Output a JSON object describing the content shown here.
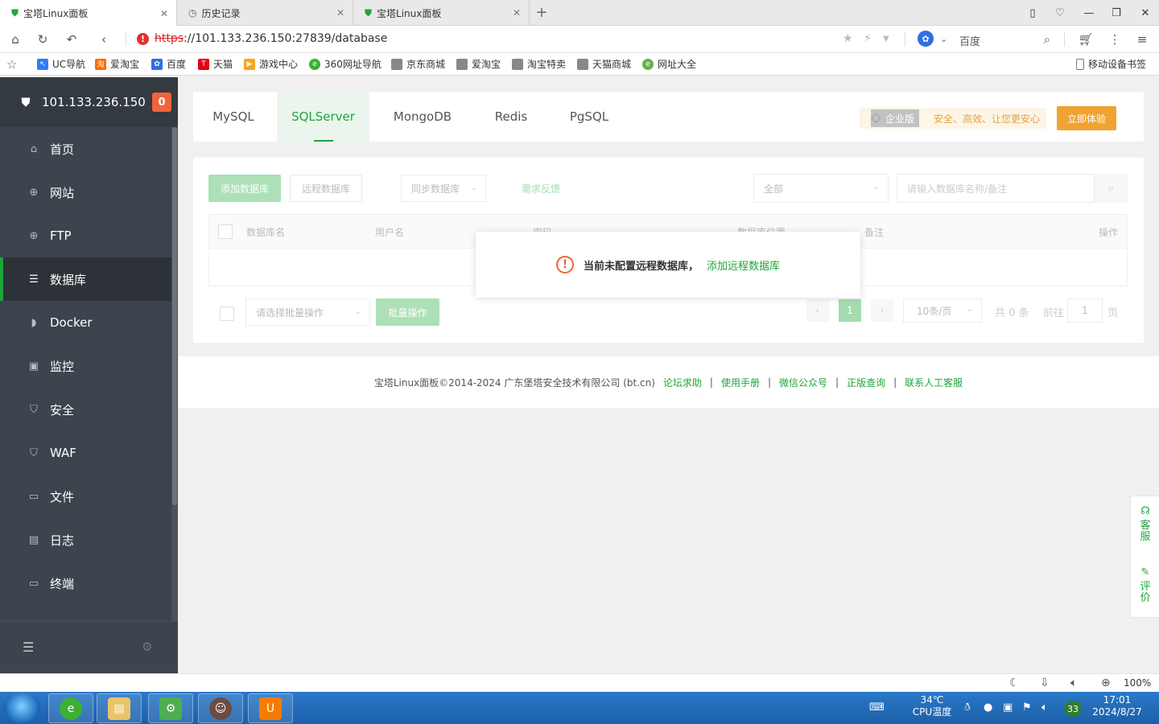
{
  "browser": {
    "tabs": [
      {
        "title": "宝塔Linux面板",
        "icon": "baota-shield-icon",
        "active": true
      },
      {
        "title": "历史记录",
        "icon": "clock-icon",
        "active": false
      },
      {
        "title": "宝塔Linux面板",
        "icon": "baota-shield-icon",
        "active": false
      }
    ],
    "url_scheme": "https",
    "url_rest": "://101.133.236.150:27839/database",
    "search_engine": "百度",
    "bookmarks": [
      "UC导航",
      "爱淘宝",
      "百度",
      "天猫",
      "游戏中心",
      "360网址导航",
      "京东商城",
      "爱淘宝",
      "淘宝特卖",
      "天猫商城",
      "网址大全"
    ],
    "mobile_bookmarks": "移动设备书签",
    "zoom": "100%"
  },
  "sidebar": {
    "server_ip": "101.133.236.150",
    "badge": "0",
    "items": [
      {
        "label": "首页",
        "icon": "home-icon"
      },
      {
        "label": "网站",
        "icon": "globe-icon"
      },
      {
        "label": "FTP",
        "icon": "ftp-globe-icon"
      },
      {
        "label": "数据库",
        "icon": "database-icon",
        "active": true
      },
      {
        "label": "Docker",
        "icon": "docker-icon"
      },
      {
        "label": "监控",
        "icon": "monitor-icon"
      },
      {
        "label": "安全",
        "icon": "shield-icon"
      },
      {
        "label": "WAF",
        "icon": "waf-shield-icon"
      },
      {
        "label": "文件",
        "icon": "folder-icon"
      },
      {
        "label": "日志",
        "icon": "log-icon"
      },
      {
        "label": "终端",
        "icon": "terminal-icon"
      }
    ]
  },
  "db_tabs": [
    "MySQL",
    "SQLServer",
    "MongoDB",
    "Redis",
    "PgSQL"
  ],
  "active_db_tab": "SQLServer",
  "enterprise": {
    "tag": "企业版",
    "slogan": "安全、高效、让您更安心",
    "button": "立即体验"
  },
  "toolbar": {
    "add_db": "添加数据库",
    "remote_db": "远程数据库",
    "sync_db": "同步数据库",
    "feedback": "需求反馈",
    "filter_select": "全部",
    "search_placeholder": "请输入数据库名称/备注"
  },
  "table": {
    "headers": [
      "数据库名",
      "用户名",
      "密码",
      "数据库位置",
      "备注",
      "操作"
    ]
  },
  "bulk": {
    "select_placeholder": "请选择批量操作",
    "button": "批量操作"
  },
  "pagination": {
    "current": "1",
    "per_page": "10条/页",
    "total": "共 0 条",
    "goto_label": "前往",
    "goto_value": "1",
    "page_suffix": "页"
  },
  "message": {
    "text": "当前未配置远程数据库，",
    "link": "添加远程数据库"
  },
  "footer": {
    "copyright": "宝塔Linux面板©2014-2024 广东堡塔安全技术有限公司 (bt.cn)",
    "links": [
      "论坛求助",
      "使用手册",
      "微信公众号",
      "正版查询",
      "联系人工客服"
    ]
  },
  "float_panel": {
    "service": "客服",
    "review": "评价"
  },
  "taskbar": {
    "temp": "34℃",
    "temp_label": "CPU温度",
    "badge": "33",
    "time": "17:01",
    "date": "2024/8/27"
  },
  "colors": {
    "brand_green": "#20a53a",
    "sidebar_bg": "#3c444d",
    "badge_orange": "#f0643a",
    "enterprise_orange": "#f1a332"
  }
}
